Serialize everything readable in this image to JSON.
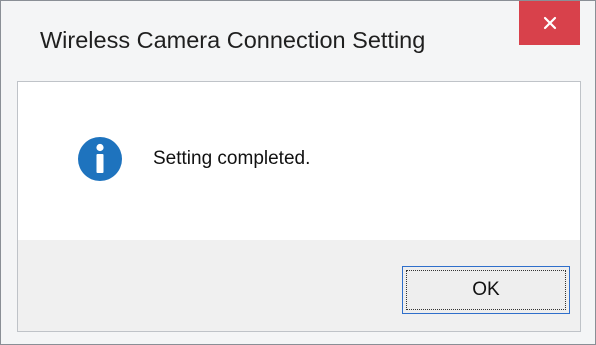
{
  "window": {
    "title": "Wireless Camera Connection Setting",
    "close_label": "×"
  },
  "dialog": {
    "icon": "info-icon",
    "message": "Setting completed.",
    "ok_label": "OK"
  },
  "colors": {
    "close_button": "#d8414b",
    "info_icon": "#1e73be",
    "content_background": "#ffffff",
    "footer_background": "#f0f0f0",
    "window_background": "#f4f5f6"
  }
}
